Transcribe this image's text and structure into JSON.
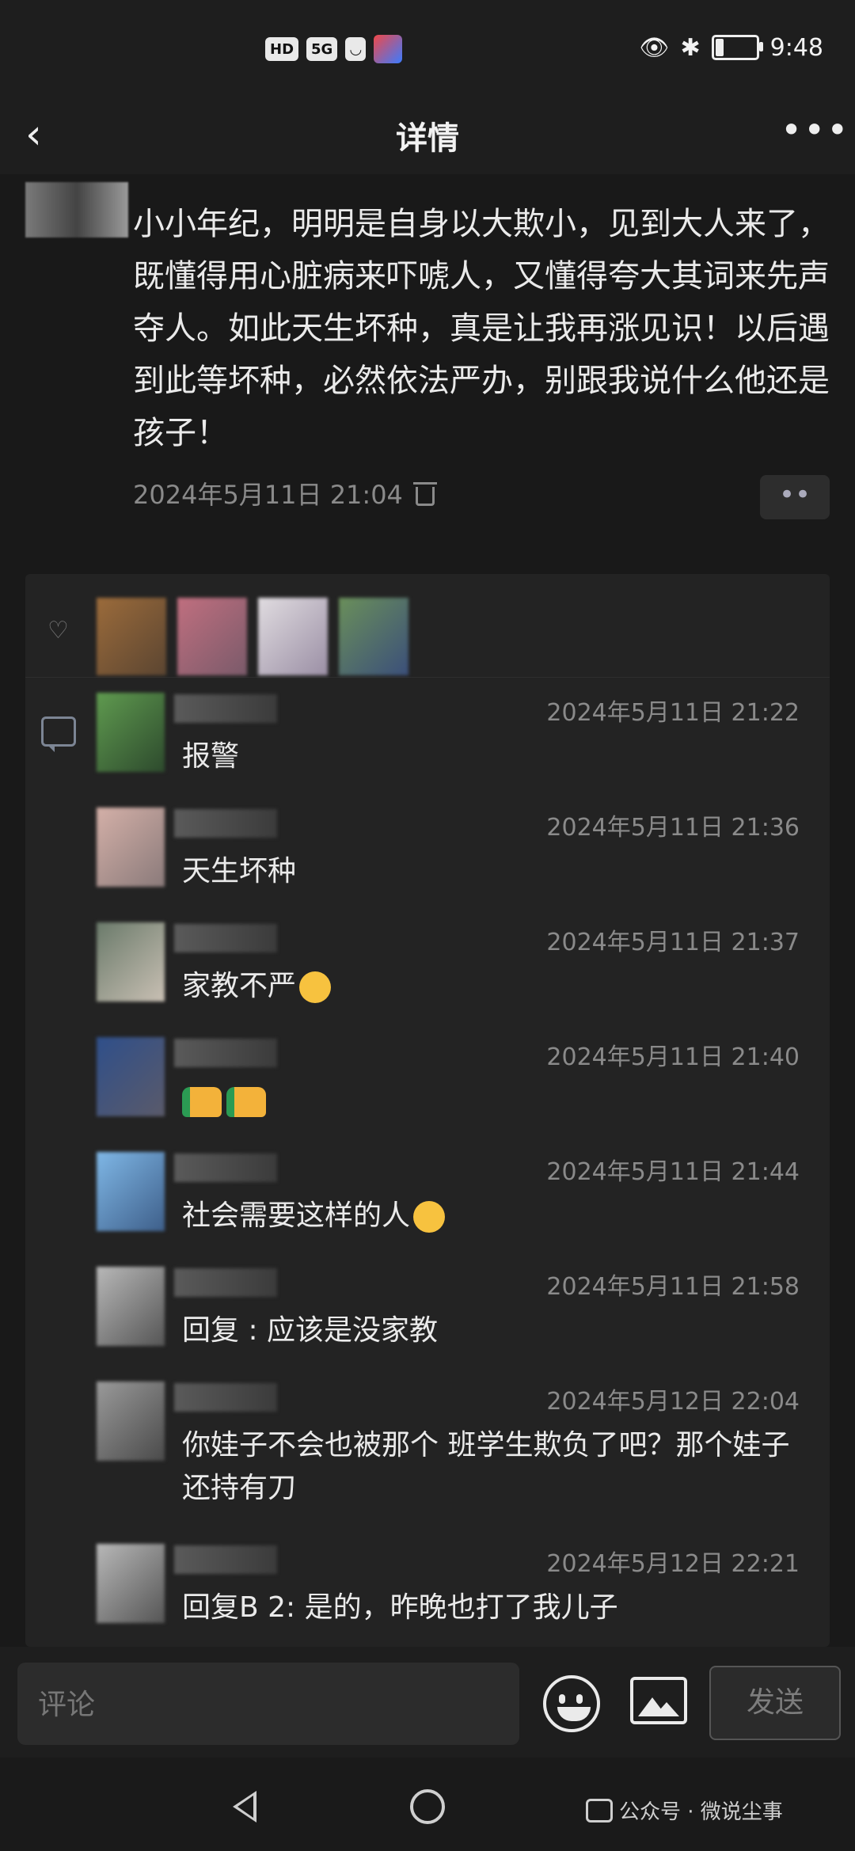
{
  "status": {
    "hd": "HD",
    "signal": "5G",
    "time": "9:48"
  },
  "nav": {
    "title": "详情",
    "more": "•••"
  },
  "post": {
    "text": "小小年纪，明明是自身以大欺小，见到大人来了，既懂得用心脏病来吓唬人，又懂得夸大其词来先声夺人。如此天生坏种，真是让我再涨见识！以后遇到此等坏种，必然依法严办，别跟我说什么他还是孩子！",
    "time": "2024年5月11日 21:04",
    "dots": "••"
  },
  "comments": [
    {
      "time": "2024年5月11日 21:22",
      "text": "报警"
    },
    {
      "time": "2024年5月11日 21:36",
      "text": "天生坏种"
    },
    {
      "time": "2024年5月11日 21:37",
      "text": "家教不严"
    },
    {
      "time": "2024年5月11日 21:40",
      "text": ""
    },
    {
      "time": "2024年5月11日 21:44",
      "text": "社会需要这样的人"
    },
    {
      "time": "2024年5月11日 21:58",
      "text": "回复 : 应该是没家教"
    },
    {
      "time": "2024年5月12日 22:04",
      "text": "你娃子不会也被那个 班学生欺负了吧？那个娃子还持有刀"
    },
    {
      "time": "2024年5月12日 22:21",
      "text": "回复B 2: 是的，昨晚也打了我儿子"
    }
  ],
  "composer": {
    "placeholder": "评论",
    "send": "发送"
  },
  "watermark": "公众号 · 微说尘事"
}
